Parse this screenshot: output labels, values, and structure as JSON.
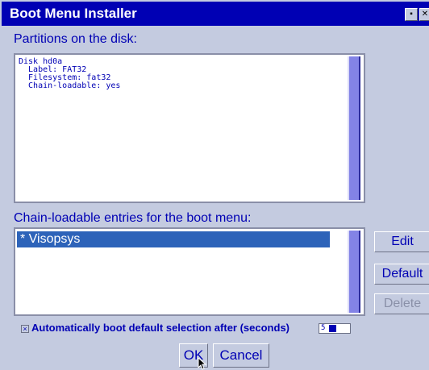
{
  "window": {
    "title": "Boot Menu Installer",
    "minimize_glyph": "▪",
    "close_glyph": "✕"
  },
  "partitions": {
    "label": "Partitions on the disk:",
    "text": "Disk hd0a\n  Label: FAT32\n  Filesystem: fat32\n  Chain-loadable: yes"
  },
  "chain": {
    "label": "Chain-loadable entries for the boot menu:",
    "items": [
      "* Visopsys"
    ]
  },
  "buttons": {
    "edit": "Edit",
    "default": "Default",
    "delete": "Delete",
    "ok": "OK",
    "cancel": "Cancel"
  },
  "autoboot": {
    "checkbox_glyph": "×",
    "label": "Automatically boot default selection after (seconds)",
    "seconds": "5"
  },
  "colors": {
    "titlebar": "#0000b4",
    "background": "#c4cbe0",
    "accent_text": "#0000b4",
    "selection": "#2d63b9",
    "scrollbar": "#8383e6"
  },
  "icons": [
    "mouse-pointer-icon",
    "checkbox-icon"
  ]
}
